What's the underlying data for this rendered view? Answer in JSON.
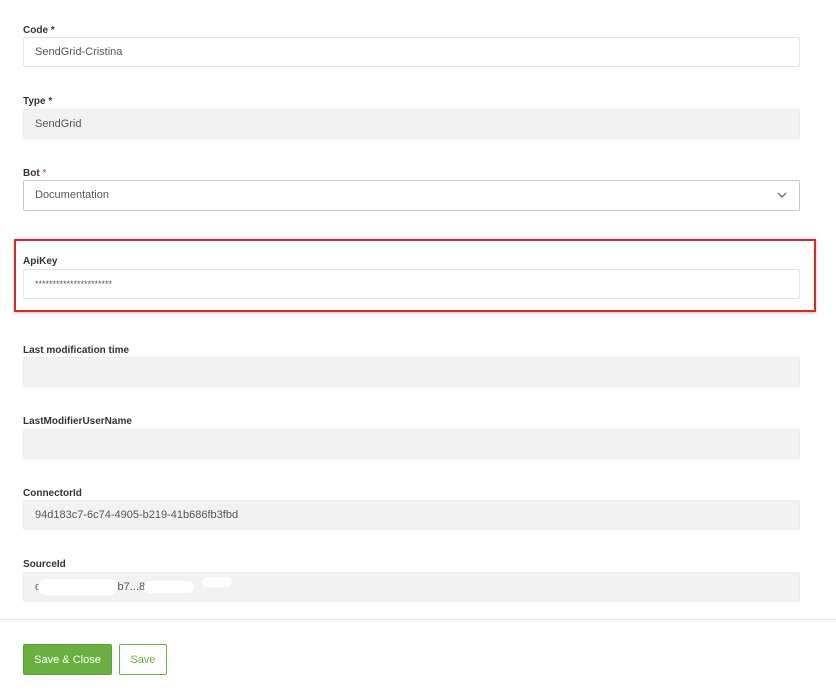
{
  "fields": {
    "code": {
      "label": "Code",
      "required_mark": "*",
      "value": "SendGrid-Cristina"
    },
    "type": {
      "label": "Type",
      "required_mark": "*",
      "value": "SendGrid"
    },
    "bot": {
      "label": "Bot",
      "required_mark": "*",
      "value": "Documentation",
      "icon": "chevron-down-icon"
    },
    "apikey": {
      "label": "ApiKey",
      "value": "**********************"
    },
    "last_modification_time": {
      "label": "Last modification time",
      "value": ""
    },
    "last_modifier_user_name": {
      "label": "LastModifierUserName",
      "value": ""
    },
    "connector_id": {
      "label": "ConnectorId",
      "value": "94d183c7-6c74-4905-b219-41b686fb3fbd"
    },
    "source_id": {
      "label": "SourceId",
      "value": "c01...d9be-9ce5-b7...82"
    }
  },
  "buttons": {
    "save_close": "Save & Close",
    "save": "Save"
  },
  "colors": {
    "accent_green": "#6ab040",
    "highlight_red": "#d42a2a",
    "readonly_bg": "#f2f2f2"
  }
}
